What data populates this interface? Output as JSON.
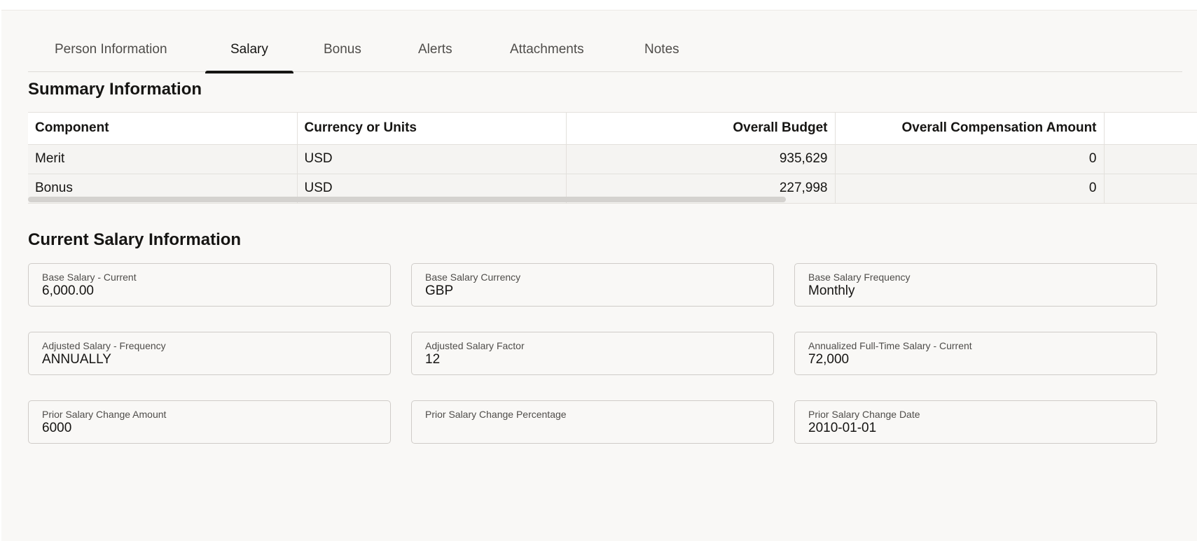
{
  "tabs": [
    {
      "label": "Person Information"
    },
    {
      "label": "Salary"
    },
    {
      "label": "Bonus"
    },
    {
      "label": "Alerts"
    },
    {
      "label": "Attachments"
    },
    {
      "label": "Notes"
    }
  ],
  "active_tab": "Salary",
  "summary": {
    "title": "Summary Information",
    "columns": [
      "Component",
      "Currency or Units",
      "Overall Budget",
      "Overall Compensation Amount"
    ],
    "rows": [
      {
        "component": "Merit",
        "currency": "USD",
        "budget": "935,629",
        "compensation": "0"
      },
      {
        "component": "Bonus",
        "currency": "USD",
        "budget": "227,998",
        "compensation": "0"
      }
    ]
  },
  "current_salary": {
    "title": "Current Salary Information",
    "fields": [
      {
        "label": "Base Salary - Current",
        "value": "6,000.00"
      },
      {
        "label": "Base Salary Currency",
        "value": "GBP"
      },
      {
        "label": "Base Salary Frequency",
        "value": "Monthly"
      },
      {
        "label": "Adjusted Salary - Frequency",
        "value": "ANNUALLY"
      },
      {
        "label": "Adjusted Salary Factor",
        "value": "12"
      },
      {
        "label": "Annualized Full-Time Salary - Current",
        "value": "72,000"
      },
      {
        "label": "Prior Salary Change Amount",
        "value": "6000"
      },
      {
        "label": "Prior Salary Change Percentage",
        "value": ""
      },
      {
        "label": "Prior Salary Change Date",
        "value": "2010-01-01"
      }
    ]
  }
}
